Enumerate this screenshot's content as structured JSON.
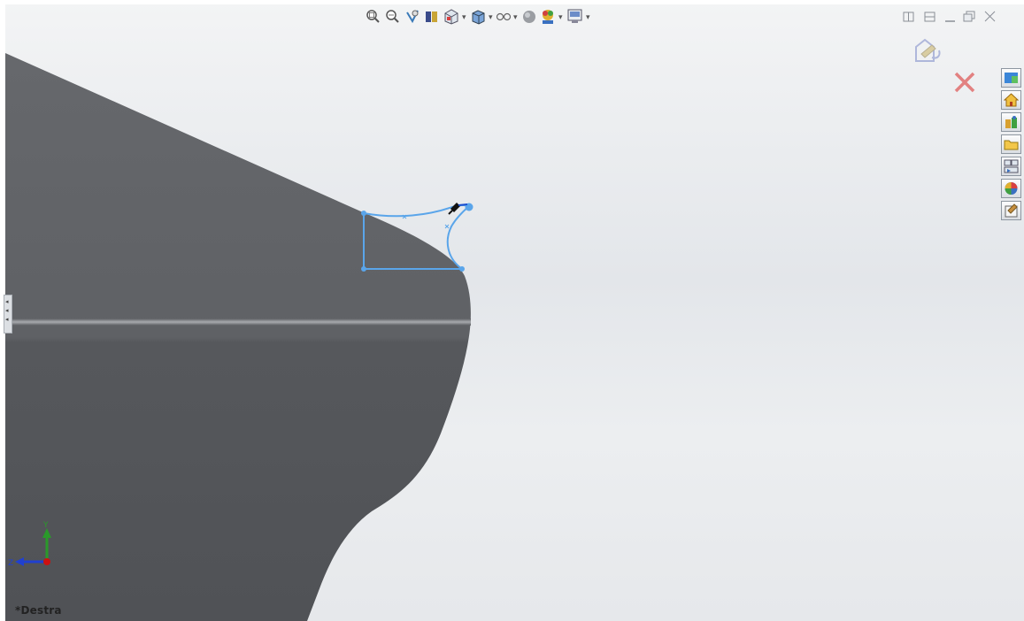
{
  "view": {
    "name": "*Destra"
  },
  "heads_up_toolbar": {
    "items": [
      {
        "name": "zoom-to-fit-icon",
        "has_dropdown": false
      },
      {
        "name": "zoom-to-area-icon",
        "has_dropdown": false
      },
      {
        "name": "previous-view-icon",
        "has_dropdown": false
      },
      {
        "name": "section-view-icon",
        "has_dropdown": false
      },
      {
        "name": "view-orientation-icon",
        "has_dropdown": true
      },
      {
        "name": "display-style-icon",
        "has_dropdown": true
      },
      {
        "name": "hide-show-items-icon",
        "has_dropdown": true
      },
      {
        "name": "edit-appearance-icon",
        "has_dropdown": false
      },
      {
        "name": "apply-scene-icon",
        "has_dropdown": true
      },
      {
        "name": "view-settings-icon",
        "has_dropdown": true
      }
    ]
  },
  "window_controls": [
    "split-horizontal-icon",
    "split-vertical-icon",
    "minimize-icon",
    "restore-icon",
    "close-icon"
  ],
  "confirmation_corner": {
    "exit_sketch_icon": "exit-sketch-icon",
    "cancel_icon": "cancel-icon"
  },
  "task_pane": {
    "tabs": [
      "solidworks-resources-icon",
      "home-icon",
      "design-library-icon",
      "file-explorer-icon",
      "view-palette-icon",
      "appearances-icon",
      "custom-properties-icon"
    ]
  },
  "triad": {
    "axes": [
      "Y",
      "Z"
    ]
  },
  "colors": {
    "background_top": "#f1f2f4",
    "background_bottom": "#e7e9ec",
    "part_face": "#5b5d61",
    "sketch": "#5aa5ea",
    "axis_y": "#2a9a2a",
    "axis_z": "#2040d0",
    "origin": "#cc1111"
  }
}
